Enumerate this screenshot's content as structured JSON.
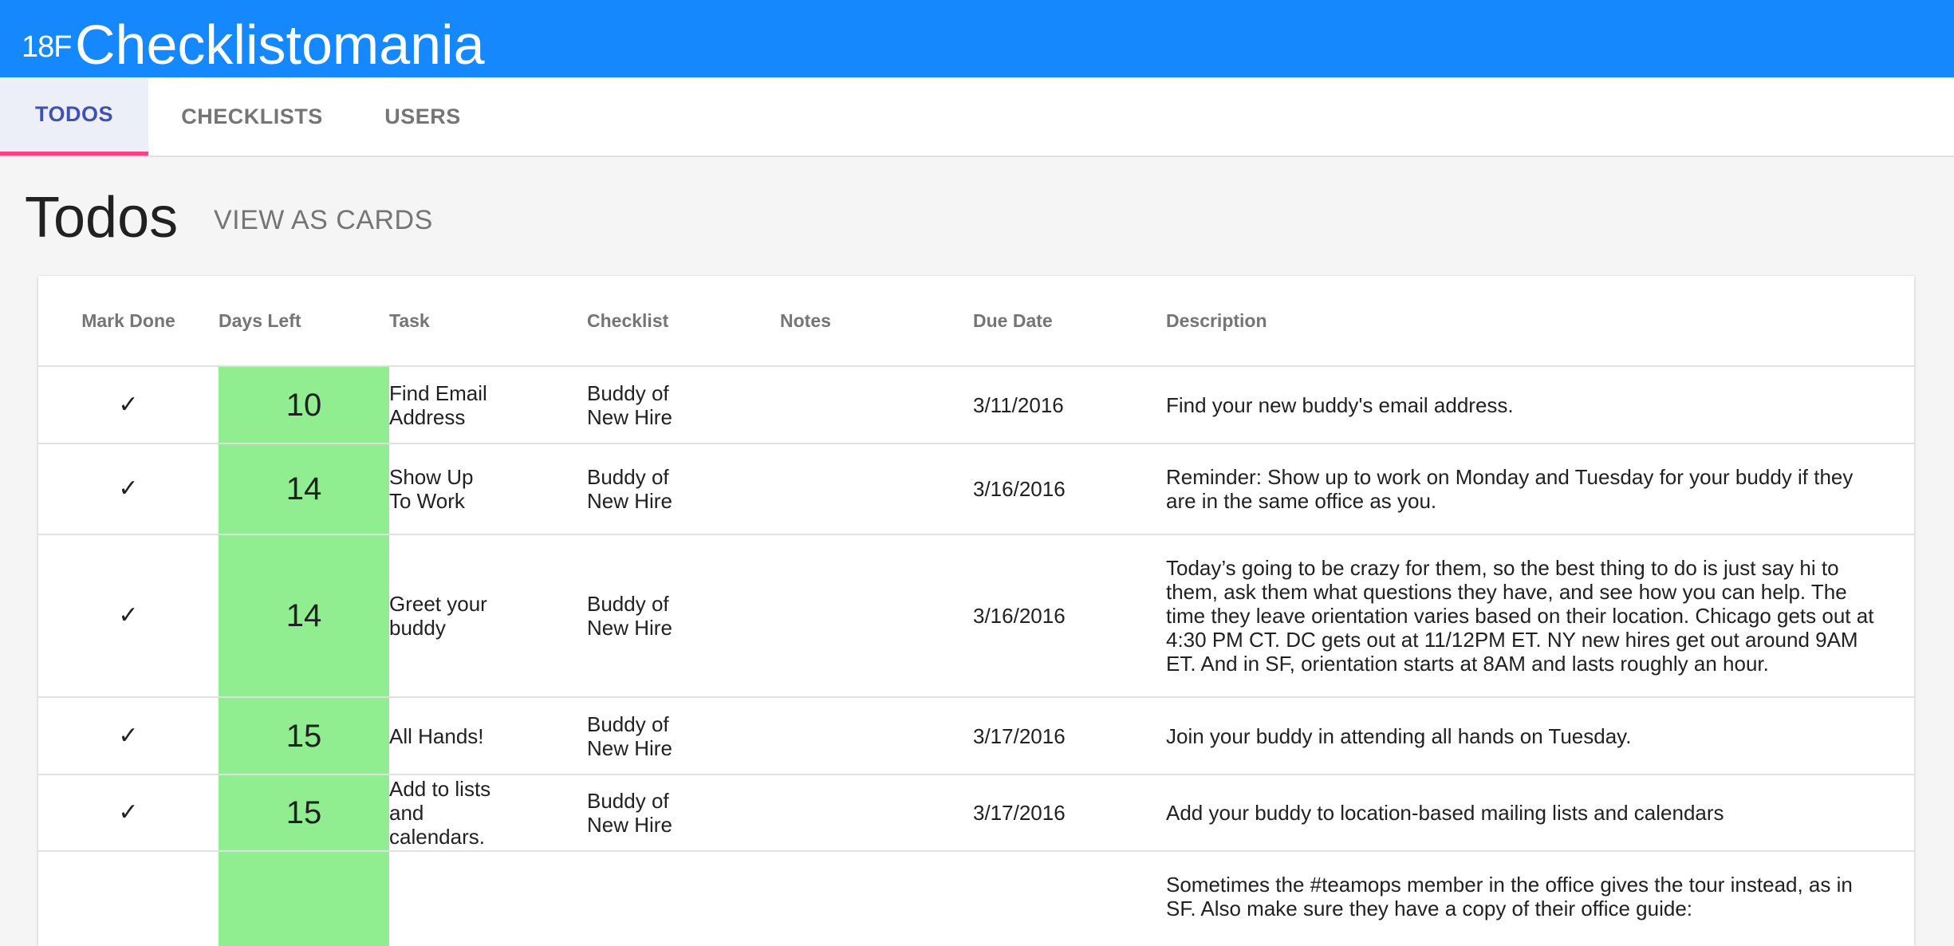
{
  "appbar": {
    "logo": "18F",
    "title": "Checklistomania"
  },
  "tabs": [
    {
      "label": "TODOS",
      "active": true
    },
    {
      "label": "CHECKLISTS",
      "active": false
    },
    {
      "label": "USERS",
      "active": false
    }
  ],
  "page": {
    "title": "Todos",
    "view_toggle": "VIEW AS CARDS"
  },
  "table": {
    "headers": [
      "Mark Done",
      "Days Left",
      "Task",
      "Checklist",
      "Notes",
      "Due Date",
      "Description"
    ],
    "rows": [
      {
        "done": "✓",
        "days_left": "10",
        "task": "Find Email Address",
        "checklist": "Buddy of New Hire",
        "notes": "",
        "due": "3/11/2016",
        "description": "Find your new buddy's email address."
      },
      {
        "done": "✓",
        "days_left": "14",
        "task": "Show Up To Work",
        "checklist": "Buddy of New Hire",
        "notes": "",
        "due": "3/16/2016",
        "description": "Reminder: Show up to work on Monday and Tuesday for your buddy if they are in the same office as you."
      },
      {
        "done": "✓",
        "days_left": "14",
        "task": "Greet your buddy",
        "checklist": "Buddy of New Hire",
        "notes": "",
        "due": "3/16/2016",
        "description": "Today’s going to be crazy for them, so the best thing to do is just say hi to them, ask them what questions they have, and see how you can help. The time they leave orientation varies based on their location. Chicago gets out at 4:30 PM CT. DC gets out at 11/12PM ET. NY new hires get out around 9AM ET. And in SF, orientation starts at 8AM and lasts roughly an hour."
      },
      {
        "done": "✓",
        "days_left": "15",
        "task": "All Hands!",
        "checklist": "Buddy of New Hire",
        "notes": "",
        "due": "3/17/2016",
        "description": "Join your buddy in attending all hands on Tuesday."
      },
      {
        "done": "✓",
        "days_left": "15",
        "task": "Add to lists and calendars.",
        "checklist": "Buddy of New Hire",
        "notes": "",
        "due": "3/17/2016",
        "description": "Add your buddy to location-based mailing lists and calendars"
      },
      {
        "done": "",
        "days_left": "",
        "task": "",
        "checklist": "",
        "notes": "",
        "due": "",
        "description": "Sometimes the #teamops member in the office gives the tour instead, as in SF. Also make sure they have a copy of their office guide:"
      }
    ]
  },
  "colors": {
    "appbar": "#1488fc",
    "active_tab_text": "#3f51b5",
    "active_tab_indicator": "#ff4081",
    "days_left_bg": "#90ee90"
  }
}
